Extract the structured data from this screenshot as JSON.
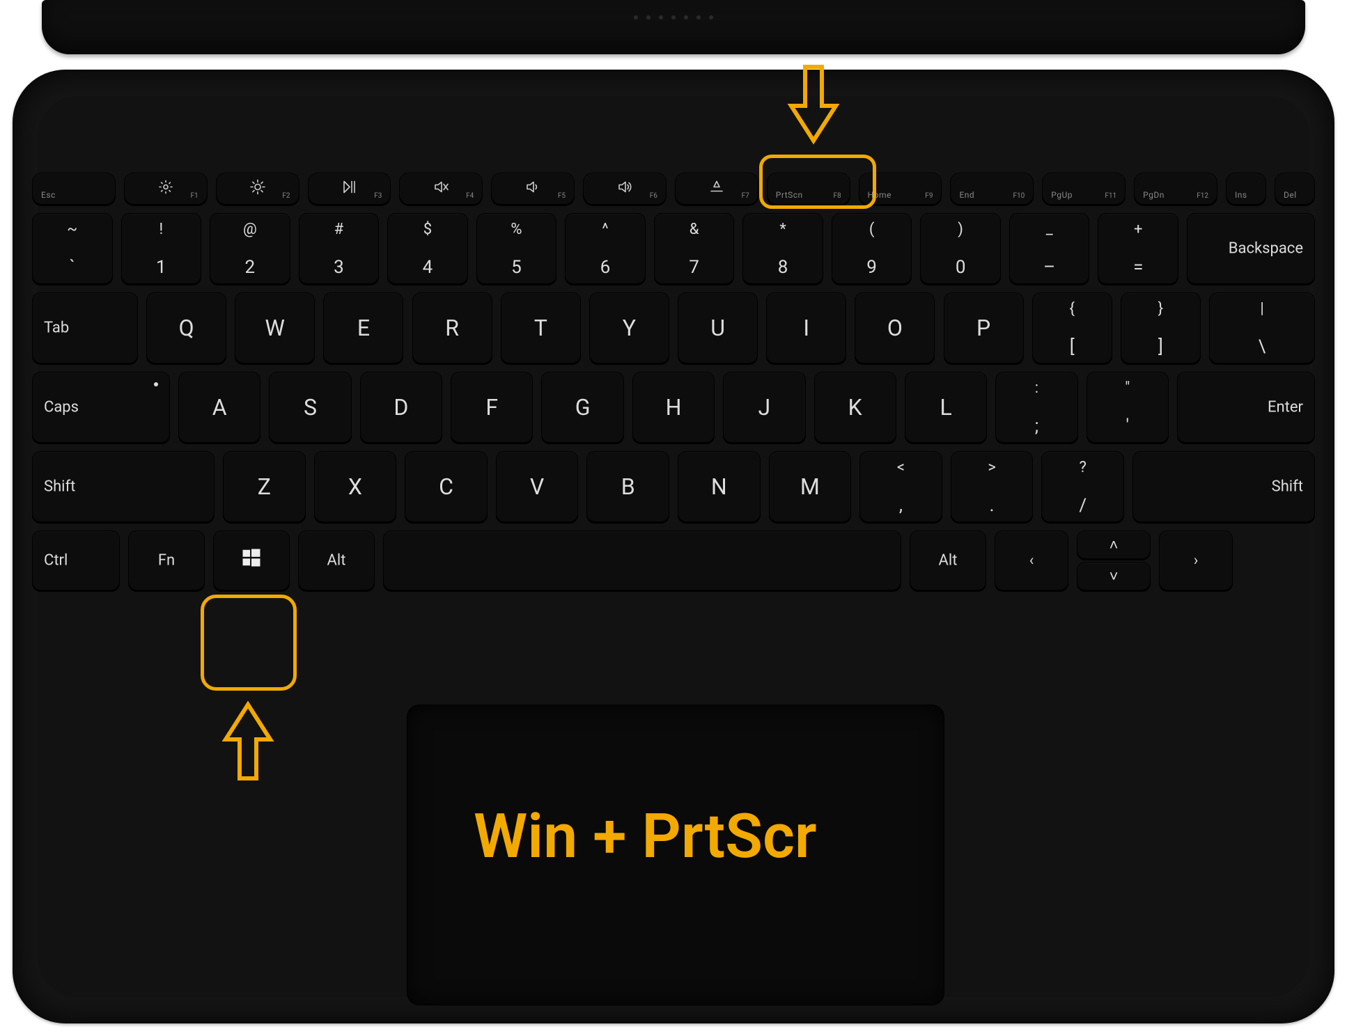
{
  "caption": "Win + PrtScr",
  "annotations": {
    "highlight_prtscn": true,
    "highlight_windows": true,
    "arrow_color": "#f2a900"
  },
  "function_row": [
    {
      "id": "esc",
      "label": "Esc",
      "sub": ""
    },
    {
      "id": "f1",
      "label": "brightness-down-icon",
      "sub": "F1",
      "icon": true
    },
    {
      "id": "f2",
      "label": "brightness-up-icon",
      "sub": "F2",
      "icon": true
    },
    {
      "id": "f3",
      "label": "play-pause-icon",
      "sub": "F3",
      "icon": true
    },
    {
      "id": "f4",
      "label": "mute-icon",
      "sub": "F4",
      "icon": true
    },
    {
      "id": "f5",
      "label": "volume-down-icon",
      "sub": "F5",
      "icon": true
    },
    {
      "id": "f6",
      "label": "volume-up-icon",
      "sub": "F6",
      "icon": true
    },
    {
      "id": "f7",
      "label": "kbd-backlight-icon",
      "sub": "F7",
      "icon": true
    },
    {
      "id": "f8",
      "label": "PrtScn",
      "sub": "F8"
    },
    {
      "id": "f9",
      "label": "Home",
      "sub": "F9"
    },
    {
      "id": "f10",
      "label": "End",
      "sub": "F10"
    },
    {
      "id": "f11",
      "label": "PgUp",
      "sub": "F11"
    },
    {
      "id": "f12",
      "label": "PgDn",
      "sub": "F12"
    },
    {
      "id": "ins",
      "label": "Ins",
      "sub": ""
    },
    {
      "id": "del",
      "label": "Del",
      "sub": ""
    }
  ],
  "row_numbers": [
    {
      "id": "tilde",
      "upper": "~",
      "lower": "`"
    },
    {
      "id": "1",
      "upper": "!",
      "lower": "1"
    },
    {
      "id": "2",
      "upper": "@",
      "lower": "2"
    },
    {
      "id": "3",
      "upper": "#",
      "lower": "3"
    },
    {
      "id": "4",
      "upper": "$",
      "lower": "4"
    },
    {
      "id": "5",
      "upper": "%",
      "lower": "5"
    },
    {
      "id": "6",
      "upper": "^",
      "lower": "6"
    },
    {
      "id": "7",
      "upper": "&",
      "lower": "7"
    },
    {
      "id": "8",
      "upper": "*",
      "lower": "8"
    },
    {
      "id": "9",
      "upper": "(",
      "lower": "9"
    },
    {
      "id": "0",
      "upper": ")",
      "lower": "0"
    },
    {
      "id": "minus",
      "upper": "_",
      "lower": "–"
    },
    {
      "id": "equals",
      "upper": "+",
      "lower": "="
    },
    {
      "id": "backspace",
      "label": "Backspace"
    }
  ],
  "row_qwerty": {
    "tab": "Tab",
    "letters": [
      "Q",
      "W",
      "E",
      "R",
      "T",
      "Y",
      "U",
      "I",
      "O",
      "P"
    ],
    "bracket_l": {
      "upper": "{",
      "lower": "["
    },
    "bracket_r": {
      "upper": "}",
      "lower": "]"
    },
    "backslash": {
      "upper": "|",
      "lower": "\\"
    }
  },
  "row_asdf": {
    "caps": "Caps",
    "letters": [
      "A",
      "S",
      "D",
      "F",
      "G",
      "H",
      "J",
      "K",
      "L"
    ],
    "semicolon": {
      "upper": ":",
      "lower": ";"
    },
    "quote": {
      "upper": "\"",
      "lower": "'"
    },
    "enter": "Enter"
  },
  "row_zxcv": {
    "shift_l": "Shift",
    "letters": [
      "Z",
      "X",
      "C",
      "V",
      "B",
      "N",
      "M"
    ],
    "comma": {
      "upper": "<",
      "lower": ","
    },
    "period": {
      "upper": ">",
      "lower": "."
    },
    "slash": {
      "upper": "?",
      "lower": "/"
    },
    "shift_r": "Shift"
  },
  "row_bottom": {
    "ctrl": "Ctrl",
    "fn": "Fn",
    "win": "windows-logo-icon",
    "alt_l": "Alt",
    "alt_r": "Alt",
    "left": "‹",
    "up": "˄",
    "down": "˅",
    "right": "›"
  }
}
